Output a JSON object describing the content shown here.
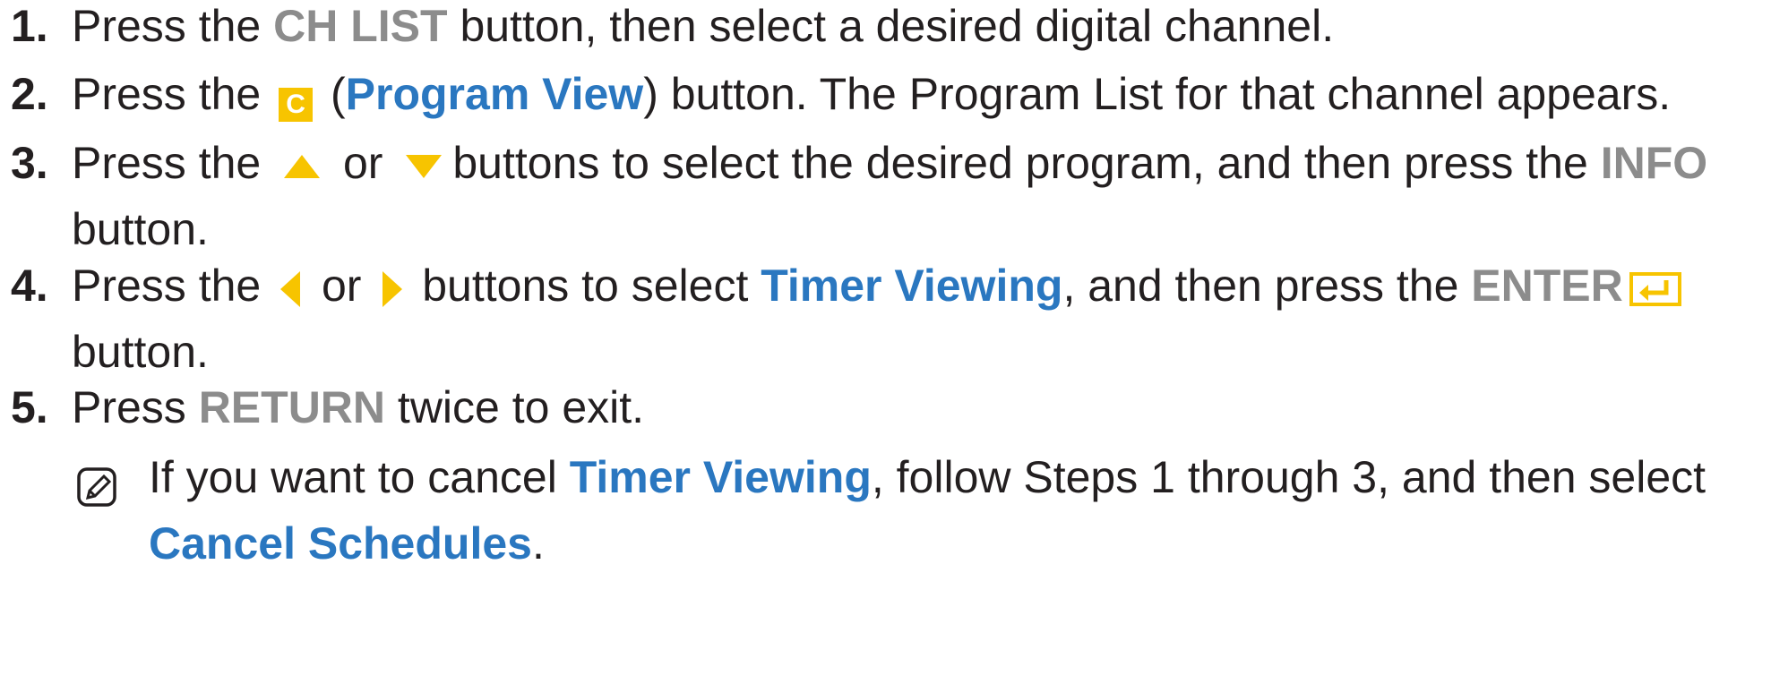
{
  "steps": [
    {
      "number": "1.",
      "prefix": "Press the ",
      "key": "CH LIST",
      "suffix": " button, then select a desired digital channel."
    },
    {
      "number": "2.",
      "prefix": "Press the ",
      "key_icon": "C",
      "open_paren": " (",
      "key": "Program View",
      "suffix": ") button. The Program List for that channel appears."
    },
    {
      "number": "3.",
      "prefix": "Press the ",
      "middle": " or ",
      "suffix": "buttons to select the desired program, and then press the ",
      "key": "INFO",
      "line2": "button.",
      "icons": [
        "up-arrow-icon",
        "down-arrow-icon"
      ]
    },
    {
      "number": "4.",
      "prefix": "Press the ",
      "middle": " or ",
      "suffix": " buttons to select ",
      "key_blue": "Timer Viewing",
      "suffix2": ", and then press the ",
      "key_gray": "ENTER",
      "line2": "button.",
      "icons": [
        "left-arrow-icon",
        "right-arrow-icon",
        "enter-icon"
      ]
    },
    {
      "number": "5.",
      "prefix": "Press ",
      "key": "RETURN",
      "suffix": " twice to exit."
    }
  ],
  "note": {
    "icon": "note-icon",
    "prefix": "If you want to cancel ",
    "key1": "Timer Viewing",
    "middle": ", follow Steps 1 through 3, and then select",
    "key2": "Cancel Schedules",
    "suffix": "."
  },
  "colors": {
    "text": "#231f20",
    "gray_key": "#8c8c8c",
    "blue_key": "#2a77c0",
    "yellow_icon": "#f7c400"
  }
}
